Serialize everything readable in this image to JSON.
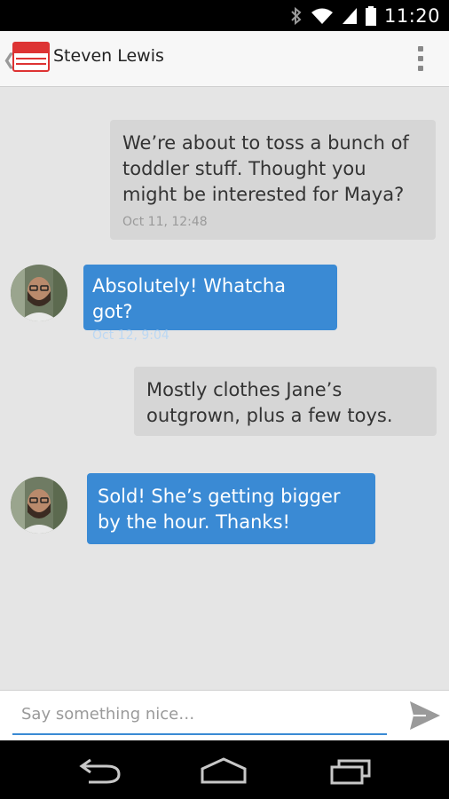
{
  "status_bar": {
    "time": "11:20",
    "icons": [
      "bluetooth-icon",
      "wifi-icon",
      "signal-icon",
      "battery-icon"
    ]
  },
  "action_bar": {
    "title": "Steven Lewis",
    "icons": [
      "back-chevron-icon",
      "app-logo-icon",
      "overflow-menu-icon"
    ]
  },
  "messages": [
    {
      "direction": "outgoing",
      "text": "We’re about to toss a bunch of toddler stuff. Thought you might be interested for Maya?",
      "time": "Oct 11, 12:48"
    },
    {
      "direction": "incoming",
      "text": "Absolutely! Whatcha got?",
      "time": "Oct 12, 9:04"
    },
    {
      "direction": "outgoing",
      "text": "Mostly clothes Jane’s outgrown, plus a few toys.",
      "time": ""
    },
    {
      "direction": "incoming",
      "text": "Sold! She’s getting bigger by the hour. Thanks!",
      "time": ""
    }
  ],
  "composer": {
    "placeholder": "Say something nice…",
    "value": "",
    "send_icon": "send-icon"
  },
  "nav_bar": {
    "icons": [
      "back-icon",
      "home-icon",
      "recents-icon"
    ]
  },
  "colors": {
    "accent": "#3a8ad4",
    "outgoing_bubble": "#d6d6d6",
    "background": "#e5e5e5"
  }
}
